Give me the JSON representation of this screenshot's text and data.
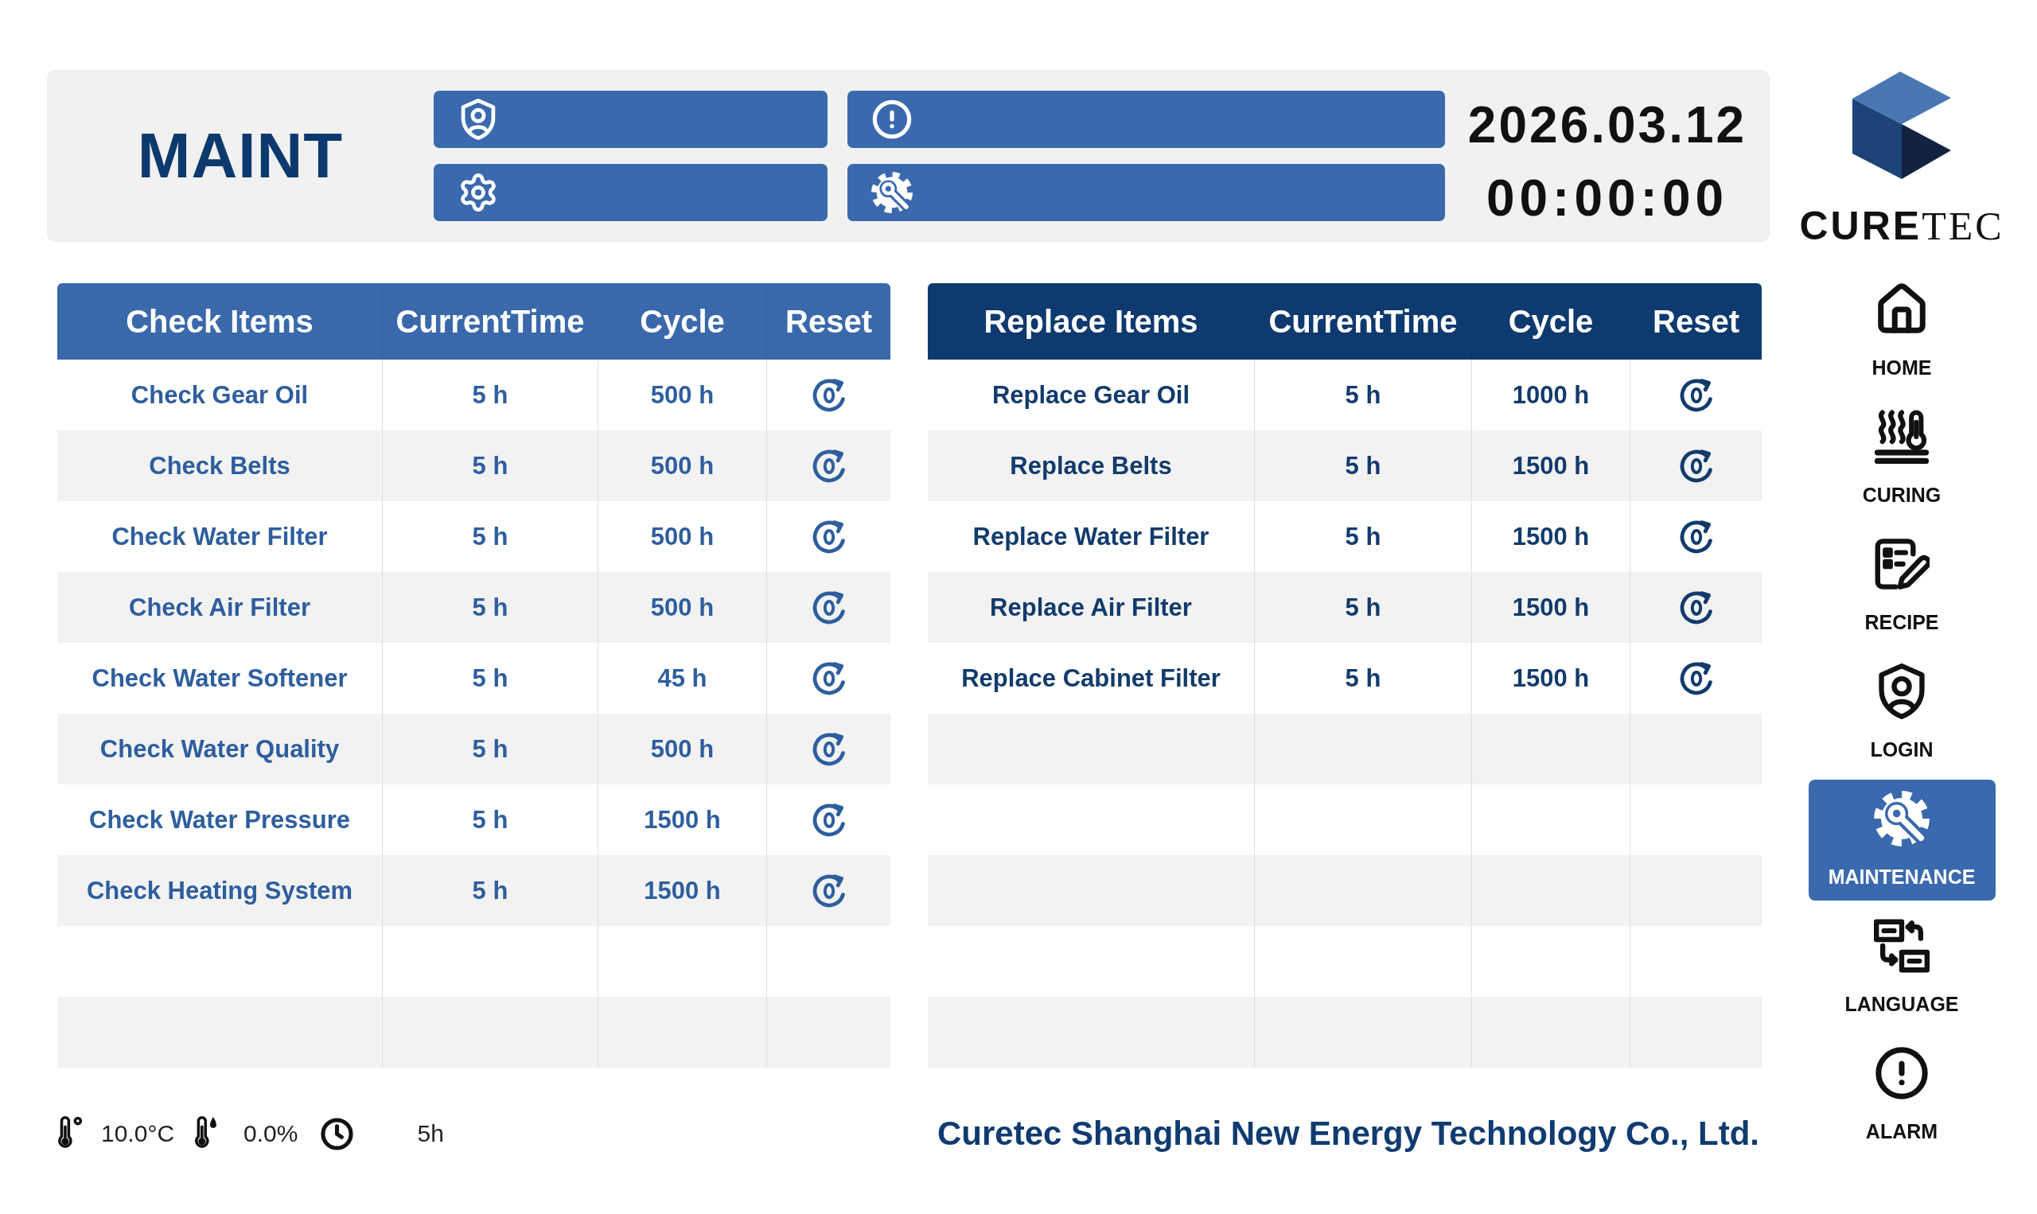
{
  "header": {
    "title": "MAINT",
    "buttons": [
      {
        "kind": "login"
      },
      {
        "kind": "alarm"
      },
      {
        "kind": "settings"
      },
      {
        "kind": "maintenance"
      }
    ],
    "date": "2026.03.12",
    "time": "00:00:00"
  },
  "logo": {
    "text": "**CURE**TEC"
  },
  "check_table": {
    "columns": [
      "Check Items",
      "CurrentTime",
      "Cycle",
      "Reset"
    ],
    "rows": [
      {
        "item": "Check Gear Oil",
        "current_time": "5 h",
        "cycle": "500 h"
      },
      {
        "item": "Check Belts",
        "current_time": "5 h",
        "cycle": "500 h"
      },
      {
        "item": "Check Water Filter",
        "current_time": "5 h",
        "cycle": "500 h"
      },
      {
        "item": "Check Air Filter",
        "current_time": "5 h",
        "cycle": "500 h"
      },
      {
        "item": "Check Water Softener",
        "current_time": "5 h",
        "cycle": "45 h"
      },
      {
        "item": "Check Water Quality",
        "current_time": "5 h",
        "cycle": "500 h"
      },
      {
        "item": "Check Water Pressure",
        "current_time": "5 h",
        "cycle": "1500 h"
      },
      {
        "item": "Check Heating System",
        "current_time": "5 h",
        "cycle": "1500 h"
      }
    ]
  },
  "replace_table": {
    "columns": [
      "Replace Items",
      "CurrentTime",
      "Cycle",
      "Reset"
    ],
    "rows": [
      {
        "item": "Replace Gear Oil",
        "current_time": "5 h",
        "cycle": "1000 h"
      },
      {
        "item": "Replace Belts",
        "current_time": "5 h",
        "cycle": "1500 h"
      },
      {
        "item": "Replace Water Filter",
        "current_time": "5 h",
        "cycle": "1500 h"
      },
      {
        "item": "Replace Air Filter",
        "current_time": "5 h",
        "cycle": "1500 h"
      },
      {
        "item": "Replace Cabinet Filter",
        "current_time": "5 h",
        "cycle": "1500 h"
      }
    ]
  },
  "sidebar": {
    "items": [
      {
        "kind": "home",
        "label": "HOME",
        "selected": false
      },
      {
        "kind": "curing",
        "label": "CURING",
        "selected": false
      },
      {
        "kind": "recipe",
        "label": "RECIPE",
        "selected": false
      },
      {
        "kind": "login",
        "label": "LOGIN",
        "selected": false
      },
      {
        "kind": "maintenance",
        "label": "MAINTENANCE",
        "selected": true
      },
      {
        "kind": "language",
        "label": "LANGUAGE",
        "selected": false
      },
      {
        "kind": "alarm",
        "label": "ALARM",
        "selected": false
      }
    ]
  },
  "status_bar": {
    "temperature": "10.0°C",
    "humidity": "0.0%",
    "runtime": "5h",
    "company": "Curetec Shanghai New Energy Technology Co., Ltd."
  }
}
